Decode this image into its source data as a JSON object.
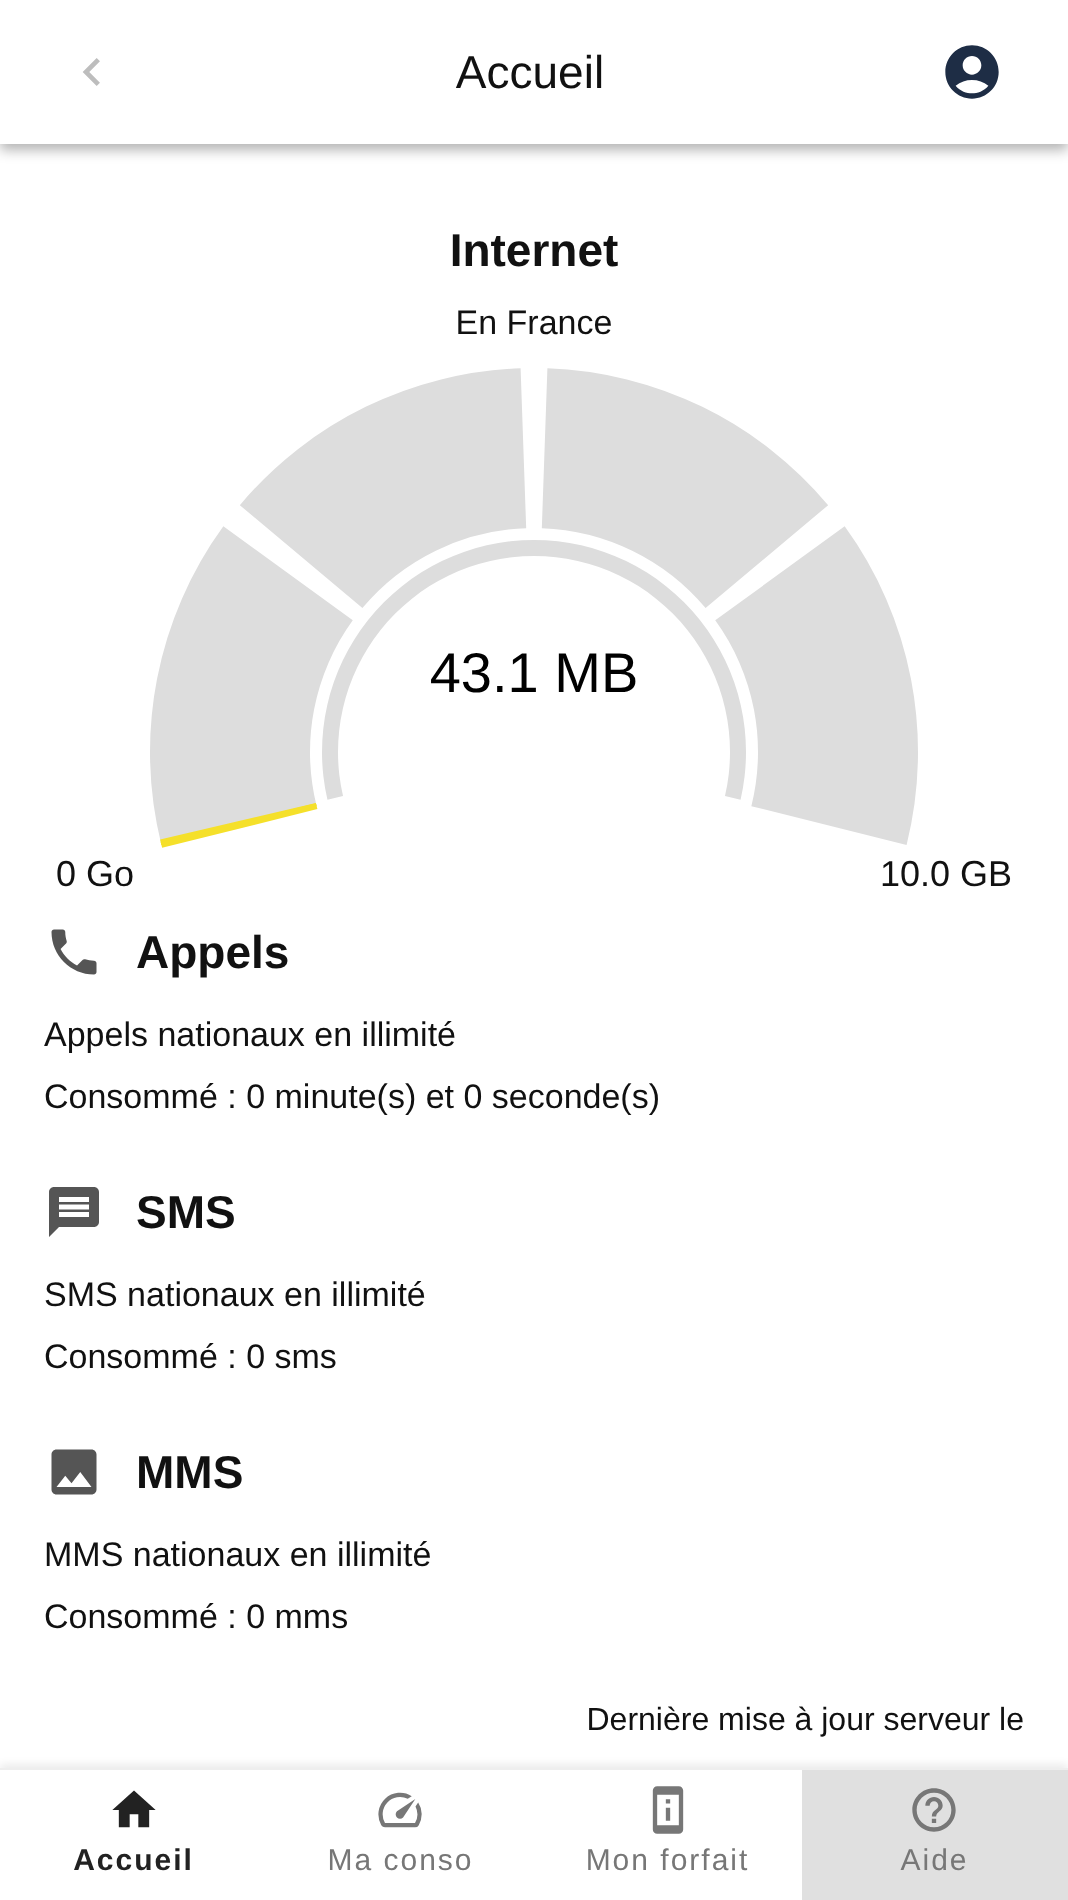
{
  "header": {
    "title": "Accueil"
  },
  "usage": {
    "title": "Internet",
    "subtitle": "En France",
    "value": "43.1 MB",
    "level": 0.004,
    "min_label": "0 Go",
    "max_label": "10.0 GB"
  },
  "sections": [
    {
      "kind": "calls",
      "title": "Appels",
      "lines": [
        "Appels nationaux en illimité",
        "Consommé : 0 minute(s) et 0 seconde(s)"
      ]
    },
    {
      "kind": "sms",
      "title": "SMS",
      "lines": [
        "SMS nationaux en illimité",
        "Consommé : 0 sms"
      ]
    },
    {
      "kind": "mms",
      "title": "MMS",
      "lines": [
        "MMS nationaux en illimité",
        "Consommé : 0 mms"
      ]
    }
  ],
  "update_note": "Dernière mise à jour serveur le",
  "nav": [
    {
      "kind": "home",
      "label": "Accueil",
      "selected": true,
      "highlighted": false
    },
    {
      "kind": "conso",
      "label": "Ma conso",
      "selected": false,
      "highlighted": false
    },
    {
      "kind": "plan",
      "label": "Mon forfait",
      "selected": false,
      "highlighted": false
    },
    {
      "kind": "help",
      "label": "Aide",
      "selected": false,
      "highlighted": true
    }
  ]
}
